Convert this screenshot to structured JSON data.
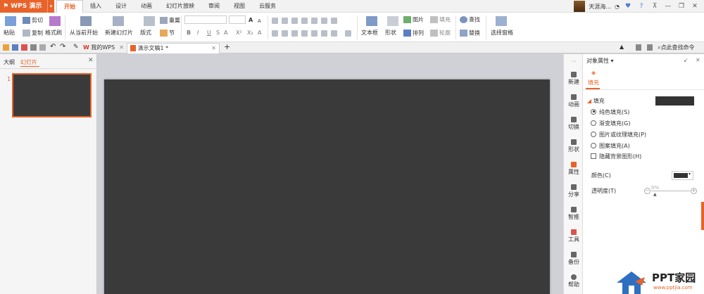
{
  "app": {
    "name": "WPS 演示",
    "dropdown": "▾"
  },
  "menu": {
    "tabs": [
      "开始",
      "插入",
      "设计",
      "动画",
      "幻灯片放映",
      "审阅",
      "视图",
      "云服务"
    ],
    "active": 0
  },
  "account": {
    "user": "天涯海...",
    "status": "◔"
  },
  "ribbon": {
    "paste": "粘贴",
    "cut": "剪切",
    "copy": "复制",
    "format_painter": "格式刷",
    "from_current": "从当前开始",
    "new_slide": "新建幻灯片",
    "layout": "版式",
    "reset": "重置",
    "section": "节",
    "font_size_up": "A",
    "font_size_down": "A",
    "bold": "B",
    "italic": "I",
    "underline": "U",
    "strike": "S",
    "font_color": "A",
    "superscript": "X²",
    "subscript": "X₂",
    "font_clear": "A",
    "textbox": "文本框",
    "shape": "形状",
    "picture": "图片",
    "fill": "填充",
    "arrange": "排列",
    "outline": "轮廓",
    "find": "查找",
    "replace": "替换",
    "select_pane": "选择窗格"
  },
  "docbar": {
    "tabs": [
      {
        "label": "我的WPS"
      },
      {
        "label": "演示文稿1 *"
      }
    ],
    "new_tab": "+",
    "search": "点此查找命令"
  },
  "left_panel": {
    "tabs": [
      "大纲",
      "幻灯片"
    ],
    "active": 1,
    "close": "✕",
    "slide_number": "1"
  },
  "sidebar": {
    "items": [
      "新建",
      "动画",
      "切换",
      "形状",
      "属性",
      "分享",
      "智推",
      "工具",
      "备份",
      "帮助"
    ]
  },
  "properties": {
    "title": "对象属性",
    "fill_tab": "填充",
    "section": "填充",
    "options": [
      "纯色填充(S)",
      "渐变填充(G)",
      "图片或纹理填充(P)",
      "图案填充(A)"
    ],
    "selected": 0,
    "hide_bg": "隐藏背景图形(H)",
    "color_label": "颜色(C)",
    "transparency_label": "透明度(T)",
    "transparency_value": "0%",
    "transparency_fraction": 0
  },
  "colors": {
    "accent": "#e8632a",
    "slide": "#3a3a3a",
    "swatch": "#333333"
  },
  "watermark": {
    "text": "PPT家园",
    "url": "www.pptjia.com"
  }
}
